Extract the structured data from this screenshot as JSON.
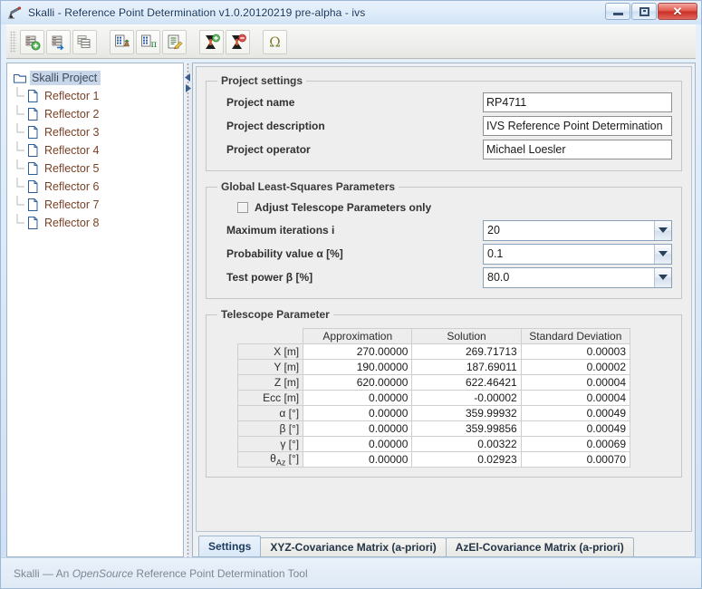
{
  "window": {
    "title": "Skalli - Reference Point Determination v1.0.20120219 pre-alpha - ivs",
    "app_icon": "telescope-icon",
    "minimize_label": "Minimize",
    "maximize_label": "Maximize",
    "close_label": "Close",
    "close_glyph": "✕"
  },
  "toolbar": {
    "buttons": [
      {
        "name": "add-dataset-button",
        "icon": "database-add-icon",
        "tooltip": "Add dataset"
      },
      {
        "name": "import-dataset-button",
        "icon": "database-import-icon",
        "tooltip": "Import dataset"
      },
      {
        "name": "copy-dataset-button",
        "icon": "database-copy-icon",
        "tooltip": "Copy dataset"
      },
      {
        "name": "import-points-button",
        "icon": "points-import-icon",
        "tooltip": "Import points"
      },
      {
        "name": "import-pi-button",
        "icon": "points-pi-icon",
        "tooltip": "Import parameters"
      },
      {
        "name": "edit-report-button",
        "icon": "report-edit-icon",
        "tooltip": "Edit report"
      },
      {
        "name": "add-telescope-button",
        "icon": "telescope-add-icon",
        "tooltip": "Add telescope"
      },
      {
        "name": "remove-telescope-button",
        "icon": "telescope-remove-icon",
        "tooltip": "Remove telescope"
      },
      {
        "name": "omega-button",
        "icon": "omega-icon",
        "tooltip": "Omega"
      }
    ]
  },
  "tree": {
    "root": {
      "label": "Skalli Project",
      "icon": "folder-icon"
    },
    "children": [
      {
        "label": "Reflector 1",
        "icon": "file-icon"
      },
      {
        "label": "Reflector 2",
        "icon": "file-icon"
      },
      {
        "label": "Reflector 3",
        "icon": "file-icon"
      },
      {
        "label": "Reflector 4",
        "icon": "file-icon"
      },
      {
        "label": "Reflector 5",
        "icon": "file-icon"
      },
      {
        "label": "Reflector 6",
        "icon": "file-icon"
      },
      {
        "label": "Reflector 7",
        "icon": "file-icon"
      },
      {
        "label": "Reflector 8",
        "icon": "file-icon"
      }
    ]
  },
  "project_settings": {
    "legend": "Project settings",
    "name_label": "Project name",
    "name_value": "RP4711",
    "name_placeholder": "",
    "description_label": "Project description",
    "description_value": "IVS Reference Point Determination",
    "description_placeholder": "",
    "operator_label": "Project operator",
    "operator_value": "Michael Loesler",
    "operator_placeholder": ""
  },
  "global_params": {
    "legend": "Global Least-Squares Parameters",
    "checkbox_label": "Adjust Telescope Parameters only",
    "checkbox_checked": false,
    "iterations_label": "Maximum iterations i",
    "iterations_value": "20",
    "alpha_label": "Probability value α [%]",
    "alpha_value": "0.1",
    "beta_label": "Test power β [%]",
    "beta_value": "80.0"
  },
  "telescope_parameter": {
    "legend": "Telescope Parameter",
    "columns": [
      "Approximation",
      "Solution",
      "Standard Deviation"
    ],
    "rows": [
      {
        "label": "X [m]",
        "sub": "",
        "values": [
          "270.00000",
          "269.71713",
          "0.00003"
        ]
      },
      {
        "label": "Y [m]",
        "sub": "",
        "values": [
          "190.00000",
          "187.69011",
          "0.00002"
        ]
      },
      {
        "label": "Z [m]",
        "sub": "",
        "values": [
          "620.00000",
          "622.46421",
          "0.00004"
        ]
      },
      {
        "label": "Ecc [m]",
        "sub": "",
        "values": [
          "0.00000",
          "-0.00002",
          "0.00004"
        ]
      },
      {
        "label": "α [°]",
        "sub": "",
        "values": [
          "0.00000",
          "359.99932",
          "0.00049"
        ]
      },
      {
        "label": "β [°]",
        "sub": "",
        "values": [
          "0.00000",
          "359.99856",
          "0.00049"
        ]
      },
      {
        "label": "γ [°]",
        "sub": "",
        "values": [
          "0.00000",
          "0.00322",
          "0.00069"
        ]
      },
      {
        "label": "θ",
        "sub": "Az",
        "suffix": " [°]",
        "values": [
          "0.00000",
          "0.02923",
          "0.00070"
        ]
      }
    ]
  },
  "tabs": [
    {
      "label": "Settings",
      "selected": true
    },
    {
      "label": "XYZ-Covariance Matrix (a-priori)",
      "selected": false
    },
    {
      "label": "AzEl-Covariance Matrix (a-priori)",
      "selected": false
    }
  ],
  "statusbar": {
    "prefix": "Skalli — An ",
    "emphasis": "OpenSource",
    "suffix": " Reference Point Determination Tool"
  },
  "colors": {
    "accent": "#3a6ea5",
    "titlebar": "#dfecfa",
    "panel": "#eeeeee",
    "close_red": "#c92d25",
    "tree_text": "#7a4126"
  }
}
